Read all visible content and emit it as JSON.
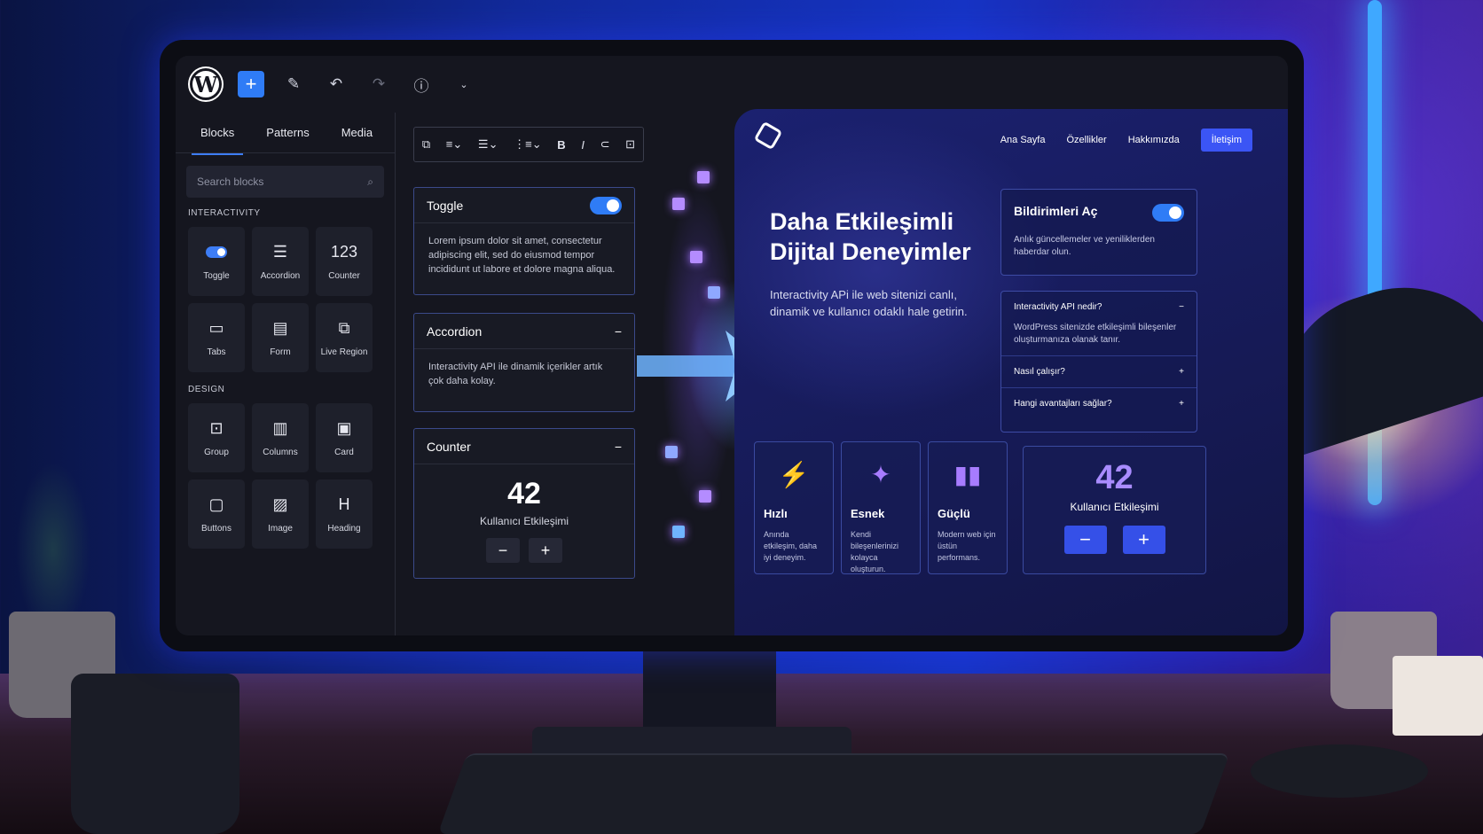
{
  "editor": {
    "sidebar_tabs": [
      "Blocks",
      "Patterns",
      "Media"
    ],
    "search_placeholder": "Search blocks",
    "interactivity_heading": "INTERACTIVITY",
    "design_heading": "DESIGN",
    "interactivity_blocks": [
      {
        "label": "Toggle",
        "icon": "toggle-icon"
      },
      {
        "label": "Accordion",
        "icon": "accordion-icon"
      },
      {
        "label": "Counter",
        "icon": "counter-icon",
        "glyph": "123"
      },
      {
        "label": "Tabs",
        "icon": "folder-icon"
      },
      {
        "label": "Form",
        "icon": "form-icon"
      },
      {
        "label": "Live Region",
        "icon": "live-region-icon"
      }
    ],
    "design_blocks": [
      {
        "label": "Group",
        "icon": "group-icon"
      },
      {
        "label": "Columns",
        "icon": "columns-icon"
      },
      {
        "label": "Card",
        "icon": "card-icon"
      },
      {
        "label": "Buttons",
        "icon": "buttons-icon"
      },
      {
        "label": "Image",
        "icon": "image-icon"
      },
      {
        "label": "Heading",
        "icon": "heading-icon"
      }
    ],
    "toggle_card": {
      "title": "Toggle",
      "body": "Lorem ipsum dolor sit amet, consectetur adipiscing elit, sed do eiusmod tempor incididunt ut labore et dolore magna aliqua.",
      "on": true
    },
    "accordion_card": {
      "title": "Accordion",
      "body": "Interactivity API ile dinamik içerikler artık çok daha kolay."
    },
    "counter_card": {
      "title": "Counter",
      "value": "42",
      "label": "Kullanıcı Etkileşimi",
      "minus": "−",
      "plus": "+"
    }
  },
  "preview": {
    "nav": [
      "Ana Sayfa",
      "Özellikler",
      "Hakkımızda"
    ],
    "nav_cta": "İletişim",
    "hero_title": "Daha Etkileşimli Dijital Deneyimler",
    "hero_sub": "Interactivity APi ile web sitenizi canlı, dinamik ve kullanıcı odaklı hale getirin.",
    "notification": {
      "title": "Bildirimleri Aç",
      "desc": "Anlık güncellemeler ve yeniliklerden haberdar olun.",
      "on": true
    },
    "faq": [
      {
        "q": "Interactivity API nedir?",
        "a": "WordPress sitenizde etkileşimli bileşenler oluşturmanıza olanak tanır.",
        "toggle": "−"
      },
      {
        "q": "Nasıl çalışır?",
        "toggle": "+"
      },
      {
        "q": "Hangi avantajları sağlar?",
        "toggle": "+"
      }
    ],
    "features": [
      {
        "title": "Hızlı",
        "desc": "Anında etkileşim, daha iyi deneyim.",
        "icon": "lightning-icon"
      },
      {
        "title": "Esnek",
        "desc": "Kendi bileşenlerinizi kolayca oluşturun.",
        "icon": "magic-wand-icon"
      },
      {
        "title": "Güçlü",
        "desc": "Modern web için üstün performans.",
        "icon": "bar-chart-icon"
      }
    ],
    "counter": {
      "value": "42",
      "label": "Kullanıcı Etkileşimi",
      "minus": "−",
      "plus": "+"
    }
  },
  "colors": {
    "accent": "#2f7cf6",
    "brand_purple": "#a98cff",
    "nav_cta": "#3b55f5"
  }
}
